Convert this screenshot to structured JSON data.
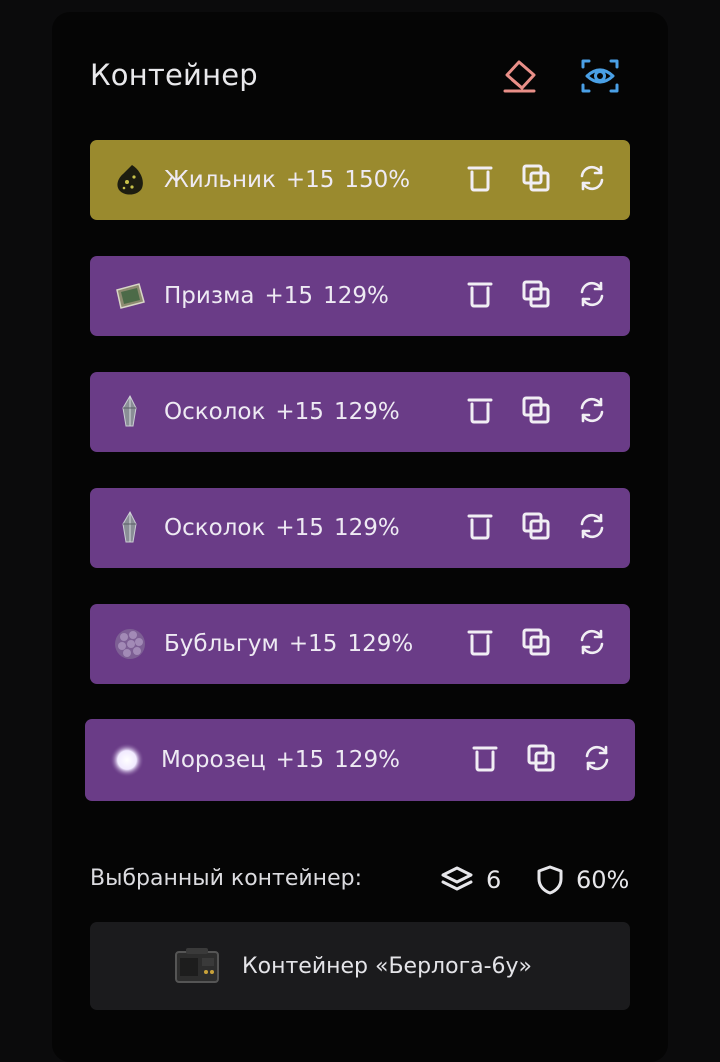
{
  "title": "Контейнер",
  "colors": {
    "gold": "#9a8a2e",
    "purple": "#6a3c87",
    "eraser": "#e98f88",
    "eye": "#4aa0e6"
  },
  "items": [
    {
      "name": "Жильник",
      "level": "+15",
      "percent": "150%",
      "color": "gold",
      "icon": "gem-icon"
    },
    {
      "name": "Призма",
      "level": "+15",
      "percent": "129%",
      "color": "purple",
      "icon": "prism-icon"
    },
    {
      "name": "Осколок",
      "level": "+15",
      "percent": "129%",
      "color": "purple",
      "icon": "shard-icon"
    },
    {
      "name": "Осколок",
      "level": "+15",
      "percent": "129%",
      "color": "purple",
      "icon": "shard-icon"
    },
    {
      "name": "Бубльгум",
      "level": "+15",
      "percent": "129%",
      "color": "purple",
      "icon": "bubblegum-icon"
    },
    {
      "name": "Морозец",
      "level": "+15",
      "percent": "129%",
      "color": "purple",
      "icon": "frost-icon"
    }
  ],
  "summary": {
    "label": "Выбранный контейнер:",
    "count": "6",
    "protection": "60%"
  },
  "container": {
    "label": "Контейнер «Берлога-6у»"
  }
}
